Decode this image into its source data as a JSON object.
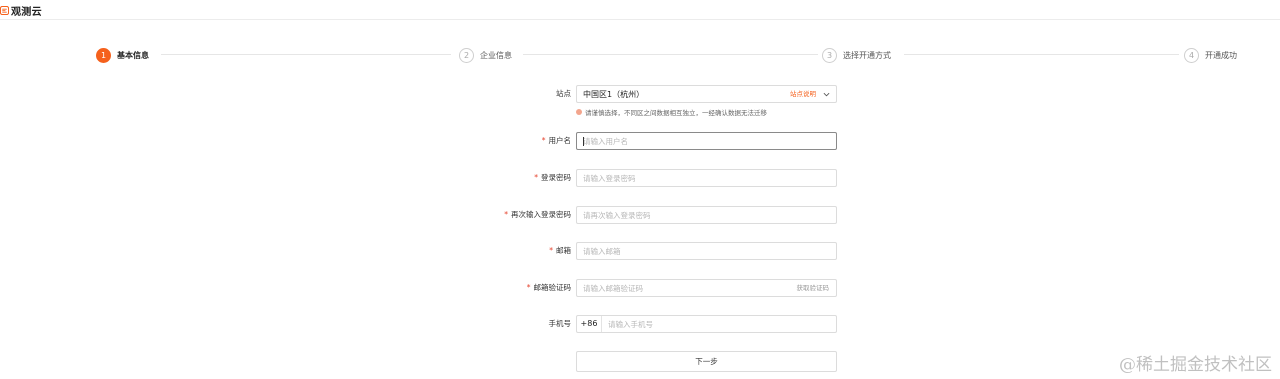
{
  "app": {
    "logo_text": "观测云"
  },
  "steps": [
    {
      "num": "1",
      "label": "基本信息"
    },
    {
      "num": "2",
      "label": "企业信息"
    },
    {
      "num": "3",
      "label": "选择开通方式"
    },
    {
      "num": "4",
      "label": "开通成功"
    }
  ],
  "form": {
    "site": {
      "label": "站点",
      "value": "中国区1（杭州）",
      "link": "站点说明",
      "hint": "请谨慎选择，不同区之间数据相互独立，一经确认数据无法迁移"
    },
    "username": {
      "label": "用户名",
      "placeholder": "请输入用户名"
    },
    "password": {
      "label": "登录密码",
      "placeholder": "请输入登录密码"
    },
    "password_confirm": {
      "label": "再次输入登录密码",
      "placeholder": "请再次输入登录密码"
    },
    "email": {
      "label": "邮箱",
      "placeholder": "请输入邮箱"
    },
    "email_code": {
      "label": "邮箱验证码",
      "placeholder": "请输入邮箱验证码",
      "action": "获取验证码"
    },
    "phone": {
      "label": "手机号",
      "prefix": "+86",
      "placeholder": "请输入手机号"
    },
    "required_mark": "*",
    "next_label": "下一步"
  },
  "watermark": "@稀土掘金技术社区",
  "colors": {
    "accent": "#f5611d",
    "required": "#e5412b"
  }
}
